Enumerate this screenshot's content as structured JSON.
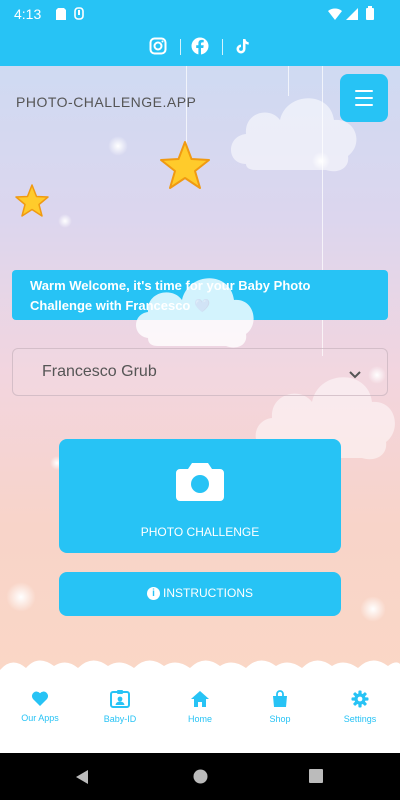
{
  "status_bar": {
    "time": "4:13"
  },
  "app": {
    "logo_text": "PHOTO-CHALLENGE.APP"
  },
  "social": {
    "icons": [
      "instagram-icon",
      "facebook-icon",
      "tiktok-icon"
    ]
  },
  "welcome": {
    "text": "Warm Welcome, it's time for your Baby Photo Challenge with Francesco 💙"
  },
  "child_select": {
    "selected": "Francesco Grub"
  },
  "photo_challenge": {
    "label": "PHOTO CHALLENGE"
  },
  "instructions": {
    "label": "INSTRUCTIONS"
  },
  "bottom_nav": {
    "items": [
      {
        "label": "Our Apps",
        "icon": "heart-icon"
      },
      {
        "label": "Baby-ID",
        "icon": "id-badge-icon"
      },
      {
        "label": "Home",
        "icon": "home-icon"
      },
      {
        "label": "Shop",
        "icon": "shopping-bag-icon"
      },
      {
        "label": "Settings",
        "icon": "gear-icon"
      }
    ]
  },
  "colors": {
    "accent": "#27c3f5",
    "text_muted": "#555555"
  }
}
